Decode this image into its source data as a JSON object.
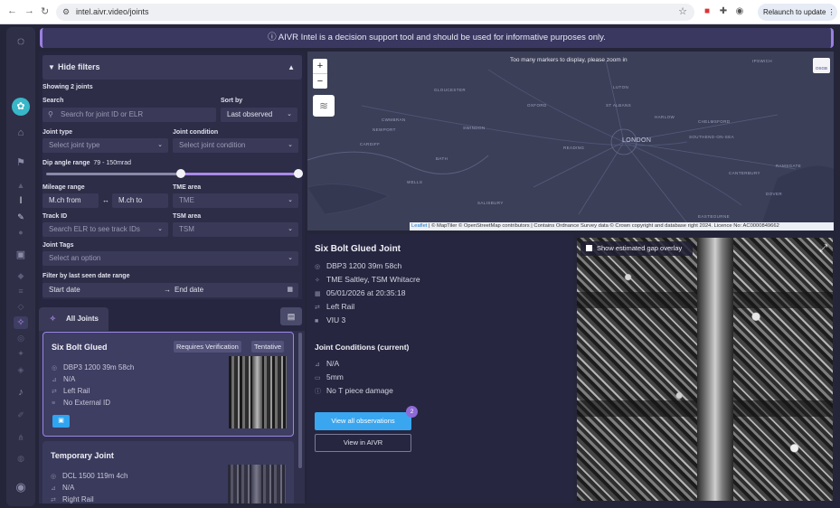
{
  "browser": {
    "url": "intel.aivr.video/joints",
    "relaunch_label": "Relaunch to update"
  },
  "banner": {
    "text": "AIVR Intel is a decision support tool and should be used for informative purposes only."
  },
  "filters": {
    "toggle_label": "Hide filters",
    "showing": "Showing 2 joints",
    "search_label": "Search",
    "search_placeholder": "Search for joint ID or ELR",
    "sort_label": "Sort by",
    "sort_value": "Last observed",
    "joint_type_label": "Joint type",
    "joint_type_placeholder": "Select joint type",
    "joint_condition_label": "Joint condition",
    "joint_condition_placeholder": "Select joint condition",
    "dip_label": "Dip angle range",
    "dip_value": "79 - 150mrad",
    "dip_min_fraction": 0.53,
    "dip_max_fraction": 1.0,
    "mileage_label": "Mileage range",
    "mileage_from_placeholder": "M.ch from",
    "mileage_to_placeholder": "M.ch to",
    "tme_label": "TME area",
    "tme_placeholder": "TME",
    "track_label": "Track ID",
    "track_placeholder": "Search ELR to see track IDs",
    "tsm_label": "TSM area",
    "tsm_placeholder": "TSM",
    "tags_label": "Joint Tags",
    "tags_placeholder": "Select an option",
    "date_label": "Filter by last seen date range",
    "start_date": "Start date",
    "end_date": "End date"
  },
  "tabs": {
    "all_joints": "All Joints"
  },
  "cards": [
    {
      "title": "Six Bolt Glued",
      "chips": [
        "Requires Verification",
        "Tentative"
      ],
      "location": "DBP3 1200 39m 58ch",
      "dip": "N/A",
      "rail": "Left Rail",
      "external_id": "No External ID"
    },
    {
      "title": "Temporary Joint",
      "location": "DCL 1500 119m 4ch",
      "dip": "N/A",
      "rail": "Right Rail"
    }
  ],
  "map": {
    "notice": "Too many markers to display, please zoom in",
    "zoom_in": "+",
    "zoom_out": "−",
    "attribution_link": "Leaflet",
    "attribution_text": "| © MapTiler © OpenStreetMap contributors | Contains Ordnance Survey data © Crown copyright and database right 2024. Licence No: AC0000849662",
    "places": [
      "GLOUCESTER",
      "LUTON",
      "IPSWICH",
      "OXFORD",
      "ST ALBANS",
      "CWMBRAN",
      "NEWPORT",
      "SWINDON",
      "HARLOW",
      "CHELMSFORD",
      "CARDIFF",
      "READING",
      "LONDON",
      "SOUTHEND-ON-SEA",
      "BATH",
      "RAMSGATE",
      "CANTERBURY",
      "WELLS",
      "DOVER",
      "SALISBURY",
      "EASTBOURNE"
    ],
    "osgb_label": "OSGB"
  },
  "detail": {
    "title": "Six Bolt Glued Joint",
    "location": "DBP3 1200 39m 58ch",
    "area": "TME Saltley, TSM Whitacre",
    "datetime": "05/01/2026 at 20:35:18",
    "rail": "Left Rail",
    "viu": "VIU 3",
    "conditions_title": "Joint Conditions (current)",
    "condition_dip": "N/A",
    "condition_gap": "5mm",
    "condition_note": "No T piece damage",
    "view_all_label": "View all observations",
    "view_all_count": "2",
    "view_aivr_label": "View in AIVR"
  },
  "photo": {
    "gap_overlay_label": "Show estimated gap overlay"
  },
  "colors": {
    "accent": "#a88be8",
    "primary_button": "#3aa6f0",
    "background": "#25253a"
  }
}
